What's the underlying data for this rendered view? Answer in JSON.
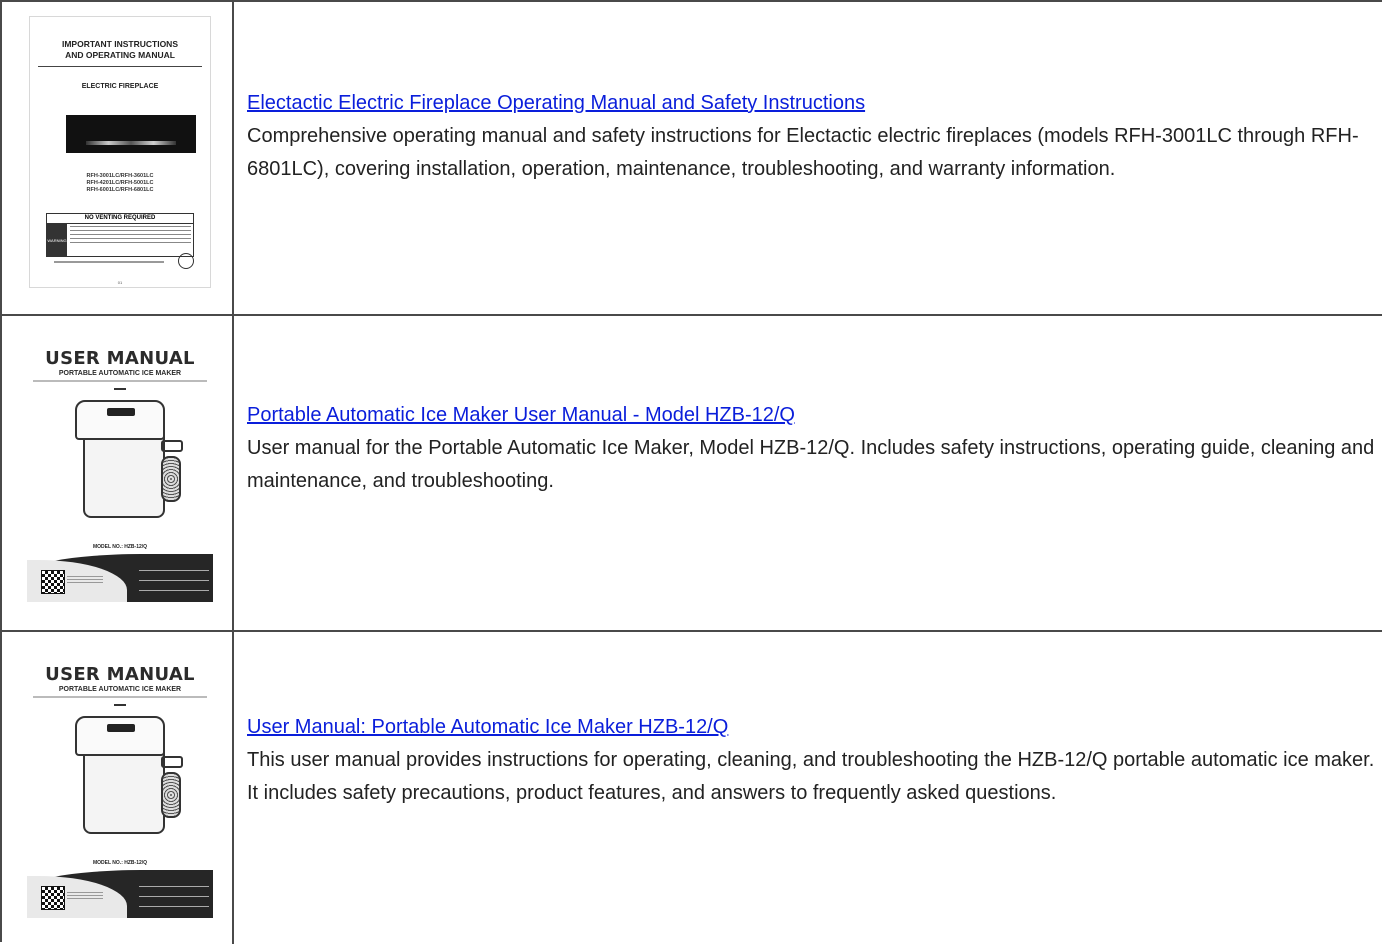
{
  "items": [
    {
      "title": "Electactic Electric Fireplace Operating Manual and Safety Instructions",
      "description": "Comprehensive operating manual and safety instructions for Electactic electric fireplaces (models RFH-3001LC through RFH-6801LC), covering installation, operation, maintenance, troubleshooting, and warranty information.",
      "thumbnail": {
        "heading_line1": "IMPORTANT INSTRUCTIONS",
        "heading_line2": "AND OPERATING MANUAL",
        "product": "ELECTRIC FIREPLACE",
        "models_line1": "RFH-3001LC/RFH-3601LC",
        "models_line2": "RFH-4201LC/RFH-5001LC",
        "models_line3": "RFH-6001LC/RFH-6801LC",
        "notice": "NO VENTING REQUIRED",
        "warning": "WARNING",
        "page": "01"
      }
    },
    {
      "title": "Portable Automatic Ice Maker User Manual - Model HZB-12/Q",
      "description": "User manual for the Portable Automatic Ice Maker, Model HZB-12/Q. Includes safety instructions, operating guide, cleaning and maintenance, and troubleshooting.",
      "thumbnail": {
        "heading": "USER MANUAL",
        "subheading": "PORTABLE AUTOMATIC ICE MAKER",
        "model": "MODEL NO.: HZB-12/Q"
      }
    },
    {
      "title": "User Manual: Portable Automatic Ice Maker HZB-12/Q",
      "description": "This user manual provides instructions for operating, cleaning, and troubleshooting the HZB-12/Q portable automatic ice maker. It includes safety precautions, product features, and answers to frequently asked questions.",
      "thumbnail": {
        "heading": "USER MANUAL",
        "subheading": "PORTABLE AUTOMATIC ICE MAKER",
        "model": "MODEL NO.: HZB-12/Q"
      }
    }
  ]
}
